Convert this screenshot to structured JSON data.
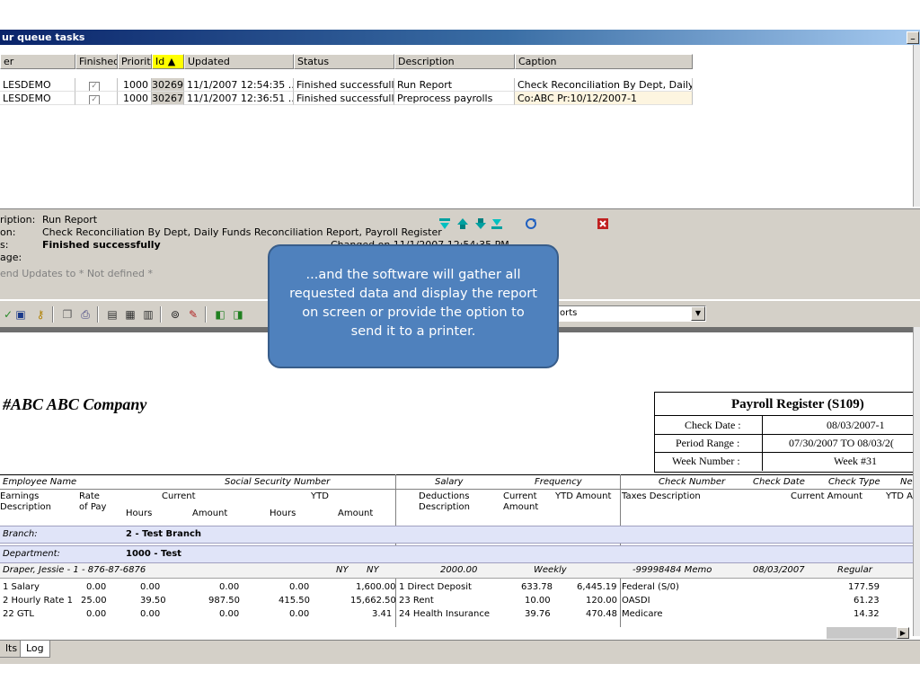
{
  "window": {
    "title": "ur queue tasks",
    "minimize_glyph": "_"
  },
  "queue": {
    "headers": [
      {
        "label": "er",
        "sorted": false
      },
      {
        "label": "Finished",
        "sorted": false
      },
      {
        "label": "Priority",
        "sorted": false
      },
      {
        "label": "Id  ▲",
        "sorted": true
      },
      {
        "label": "Updated",
        "sorted": false
      },
      {
        "label": "Status",
        "sorted": false
      },
      {
        "label": "Description",
        "sorted": false
      },
      {
        "label": "Caption",
        "sorted": false
      }
    ],
    "rows": [
      {
        "user": "LESDEMO",
        "finished": true,
        "priority": "1000",
        "id": "30269",
        "updated": "11/1/2007 12:54:35 ...",
        "status": "Finished successfully",
        "description": "Run Report",
        "caption": "Check Reconciliation By Dept, Daily..."
      },
      {
        "user": "LESDEMO",
        "finished": true,
        "priority": "1000",
        "id": "30267",
        "updated": "11/1/2007 12:36:51 ...",
        "status": "Finished successfully",
        "description": "Preprocess payrolls",
        "caption": "Co:ABC Pr:10/12/2007-1"
      }
    ]
  },
  "detail": {
    "description_label": "ription:",
    "description_value": "Run Report",
    "caption_label": "on:",
    "caption_value": "Check Reconciliation By Dept, Daily Funds Reconciliation Report, Payroll Register",
    "status_label": "s:",
    "status_value": "Finished successfully",
    "message_label": "age:",
    "send_updates": "end Updates to * Not defined *",
    "hidden_fragment": "Changed on 11/1/2007 12:54:35 PM"
  },
  "toolbar": {
    "icons": [
      "check-icon",
      "save-icon",
      "key-icon",
      "copy-icon",
      "print-icon",
      "page-first-icon",
      "page-view-icon",
      "page-last-icon",
      "binoculars-icon",
      "export-icon",
      "nav-icon",
      "nav-icon-2"
    ],
    "combo_value": "orts"
  },
  "callout": {
    "text": "...and the software will gather all requested data and display the report on screen or provide the option to send it to a printer."
  },
  "report": {
    "company": "#ABC ABC Company",
    "register_title": "Payroll Register (S109)",
    "info": [
      {
        "label": "Check Date :",
        "value": "08/03/2007-1"
      },
      {
        "label": "Period Range :",
        "value": "07/30/2007 TO 08/03/2("
      },
      {
        "label": "Week Number :",
        "value": "Week #31"
      }
    ],
    "colheads": {
      "employee_name": "Employee Name",
      "ssn": "Social Security Number",
      "salary": "Salary",
      "frequency": "Frequency",
      "check_number": "Check Number",
      "check_date": "Check Date",
      "check_type": "Check Type",
      "ne": "Ne"
    },
    "subheads": {
      "earnings": "Earnings",
      "description": "Description",
      "rate": "Rate",
      "of_pay": "of Pay",
      "current": "Current",
      "hours": "Hours",
      "amount": "Amount",
      "ytd": "YTD",
      "hours2": "Hours",
      "amount2": "Amount",
      "deductions": "Deductions",
      "ded_description": "Description",
      "ded_current": "Current",
      "ded_amount": "Amount",
      "ytd_amount": "YTD Amount",
      "taxes_description": "Taxes Description",
      "current_amount": "Current Amount",
      "ytd_a": "YTD A"
    },
    "branch_label": "Branch:",
    "branch_value": "2 - Test Branch",
    "department_label": "Department:",
    "department_value": "1000 - Test",
    "employee": {
      "name": "Draper, Jessie  - 1 - 876-87-6876",
      "state1": "NY",
      "state2": "NY",
      "salary": "2000.00",
      "frequency": "Weekly",
      "check_number": "-99998484 Memo",
      "check_date": "08/03/2007",
      "check_type": "Regular"
    },
    "lines": [
      {
        "earn": "1  Salary",
        "rate": "0.00",
        "cur_hours": "0.00",
        "cur_amount": "0.00",
        "ytd_hours": "0.00",
        "ytd_amount": "1,600.00",
        "ded": "1   Direct Deposit",
        "ded_current": "633.78",
        "ded_ytd": "6,445.19",
        "tax": "Federal (S/0)",
        "tax_current": "177.59"
      },
      {
        "earn": "2  Hourly Rate 1",
        "rate": "25.00",
        "cur_hours": "39.50",
        "cur_amount": "987.50",
        "ytd_hours": "415.50",
        "ytd_amount": "15,662.50",
        "ded": "23 Rent",
        "ded_current": "10.00",
        "ded_ytd": "120.00",
        "tax": "OASDI",
        "tax_current": "61.23"
      },
      {
        "earn": "22 GTL",
        "rate": "0.00",
        "cur_hours": "0.00",
        "cur_amount": "0.00",
        "ytd_hours": "0.00",
        "ytd_amount": "3.41",
        "ded": "24 Health Insurance",
        "ded_current": "39.76",
        "ded_ytd": "470.48",
        "tax": "Medicare",
        "tax_current": "14.32"
      }
    ]
  },
  "tabs": [
    {
      "label": "lts",
      "active": false
    },
    {
      "label": "Log",
      "active": true
    }
  ],
  "colors": {
    "title_gradient_start": "#0a246a",
    "callout_fill": "#4f81bd",
    "sorted_header": "#ffff00",
    "panel_gray": "#d4d0c8"
  }
}
